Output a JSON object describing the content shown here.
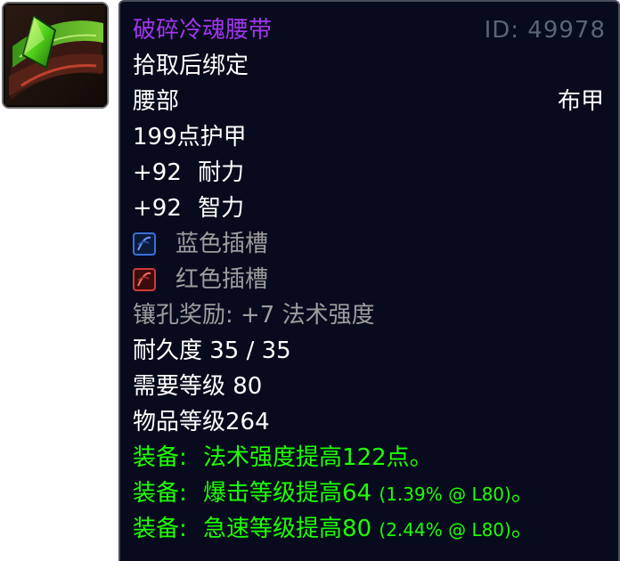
{
  "item": {
    "name": "破碎冷魂腰带",
    "id_text": "ID: 49978",
    "binding": "拾取后绑定",
    "slot": "腰部",
    "armor_type": "布甲",
    "armor": "199点护甲",
    "stats": [
      {
        "value": "+92",
        "name": "耐力"
      },
      {
        "value": "+92",
        "name": "智力"
      }
    ],
    "sockets": [
      {
        "label": "蓝色插槽",
        "color": "#3a6fd8",
        "icon": "blue-socket-icon"
      },
      {
        "label": "红色插槽",
        "color": "#d23a3a",
        "icon": "red-socket-icon"
      }
    ],
    "socket_bonus": "镶孔奖励: +7 法术强度",
    "durability": "耐久度 35 / 35",
    "required_level": "需要等级 80",
    "item_level": "物品等级264",
    "equip_effects": [
      {
        "prefix": "装备:",
        "text": "法术强度提高122点。",
        "detail": "",
        "suffix": ""
      },
      {
        "prefix": "装备:",
        "text": "爆击等级提高64",
        "detail": "(1.39% @ L80)",
        "suffix": "。"
      },
      {
        "prefix": "装备:",
        "text": "急速等级提高80",
        "detail": "(2.44% @ L80)",
        "suffix": "。"
      }
    ]
  },
  "colors": {
    "epic": "#a335ee",
    "gray": "#9d9d9d",
    "green": "#1eff00",
    "background": "#070b1d"
  },
  "icon": {
    "name": "belt-icon"
  }
}
